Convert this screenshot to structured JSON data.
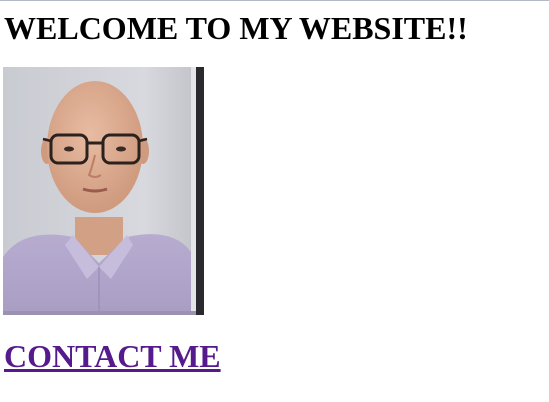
{
  "page": {
    "heading": "WELCOME TO MY WEBSITE!!",
    "contact_link": "CONTACT ME"
  },
  "colors": {
    "link_visited": "#551a8b",
    "text": "#000000",
    "background": "#ffffff"
  }
}
